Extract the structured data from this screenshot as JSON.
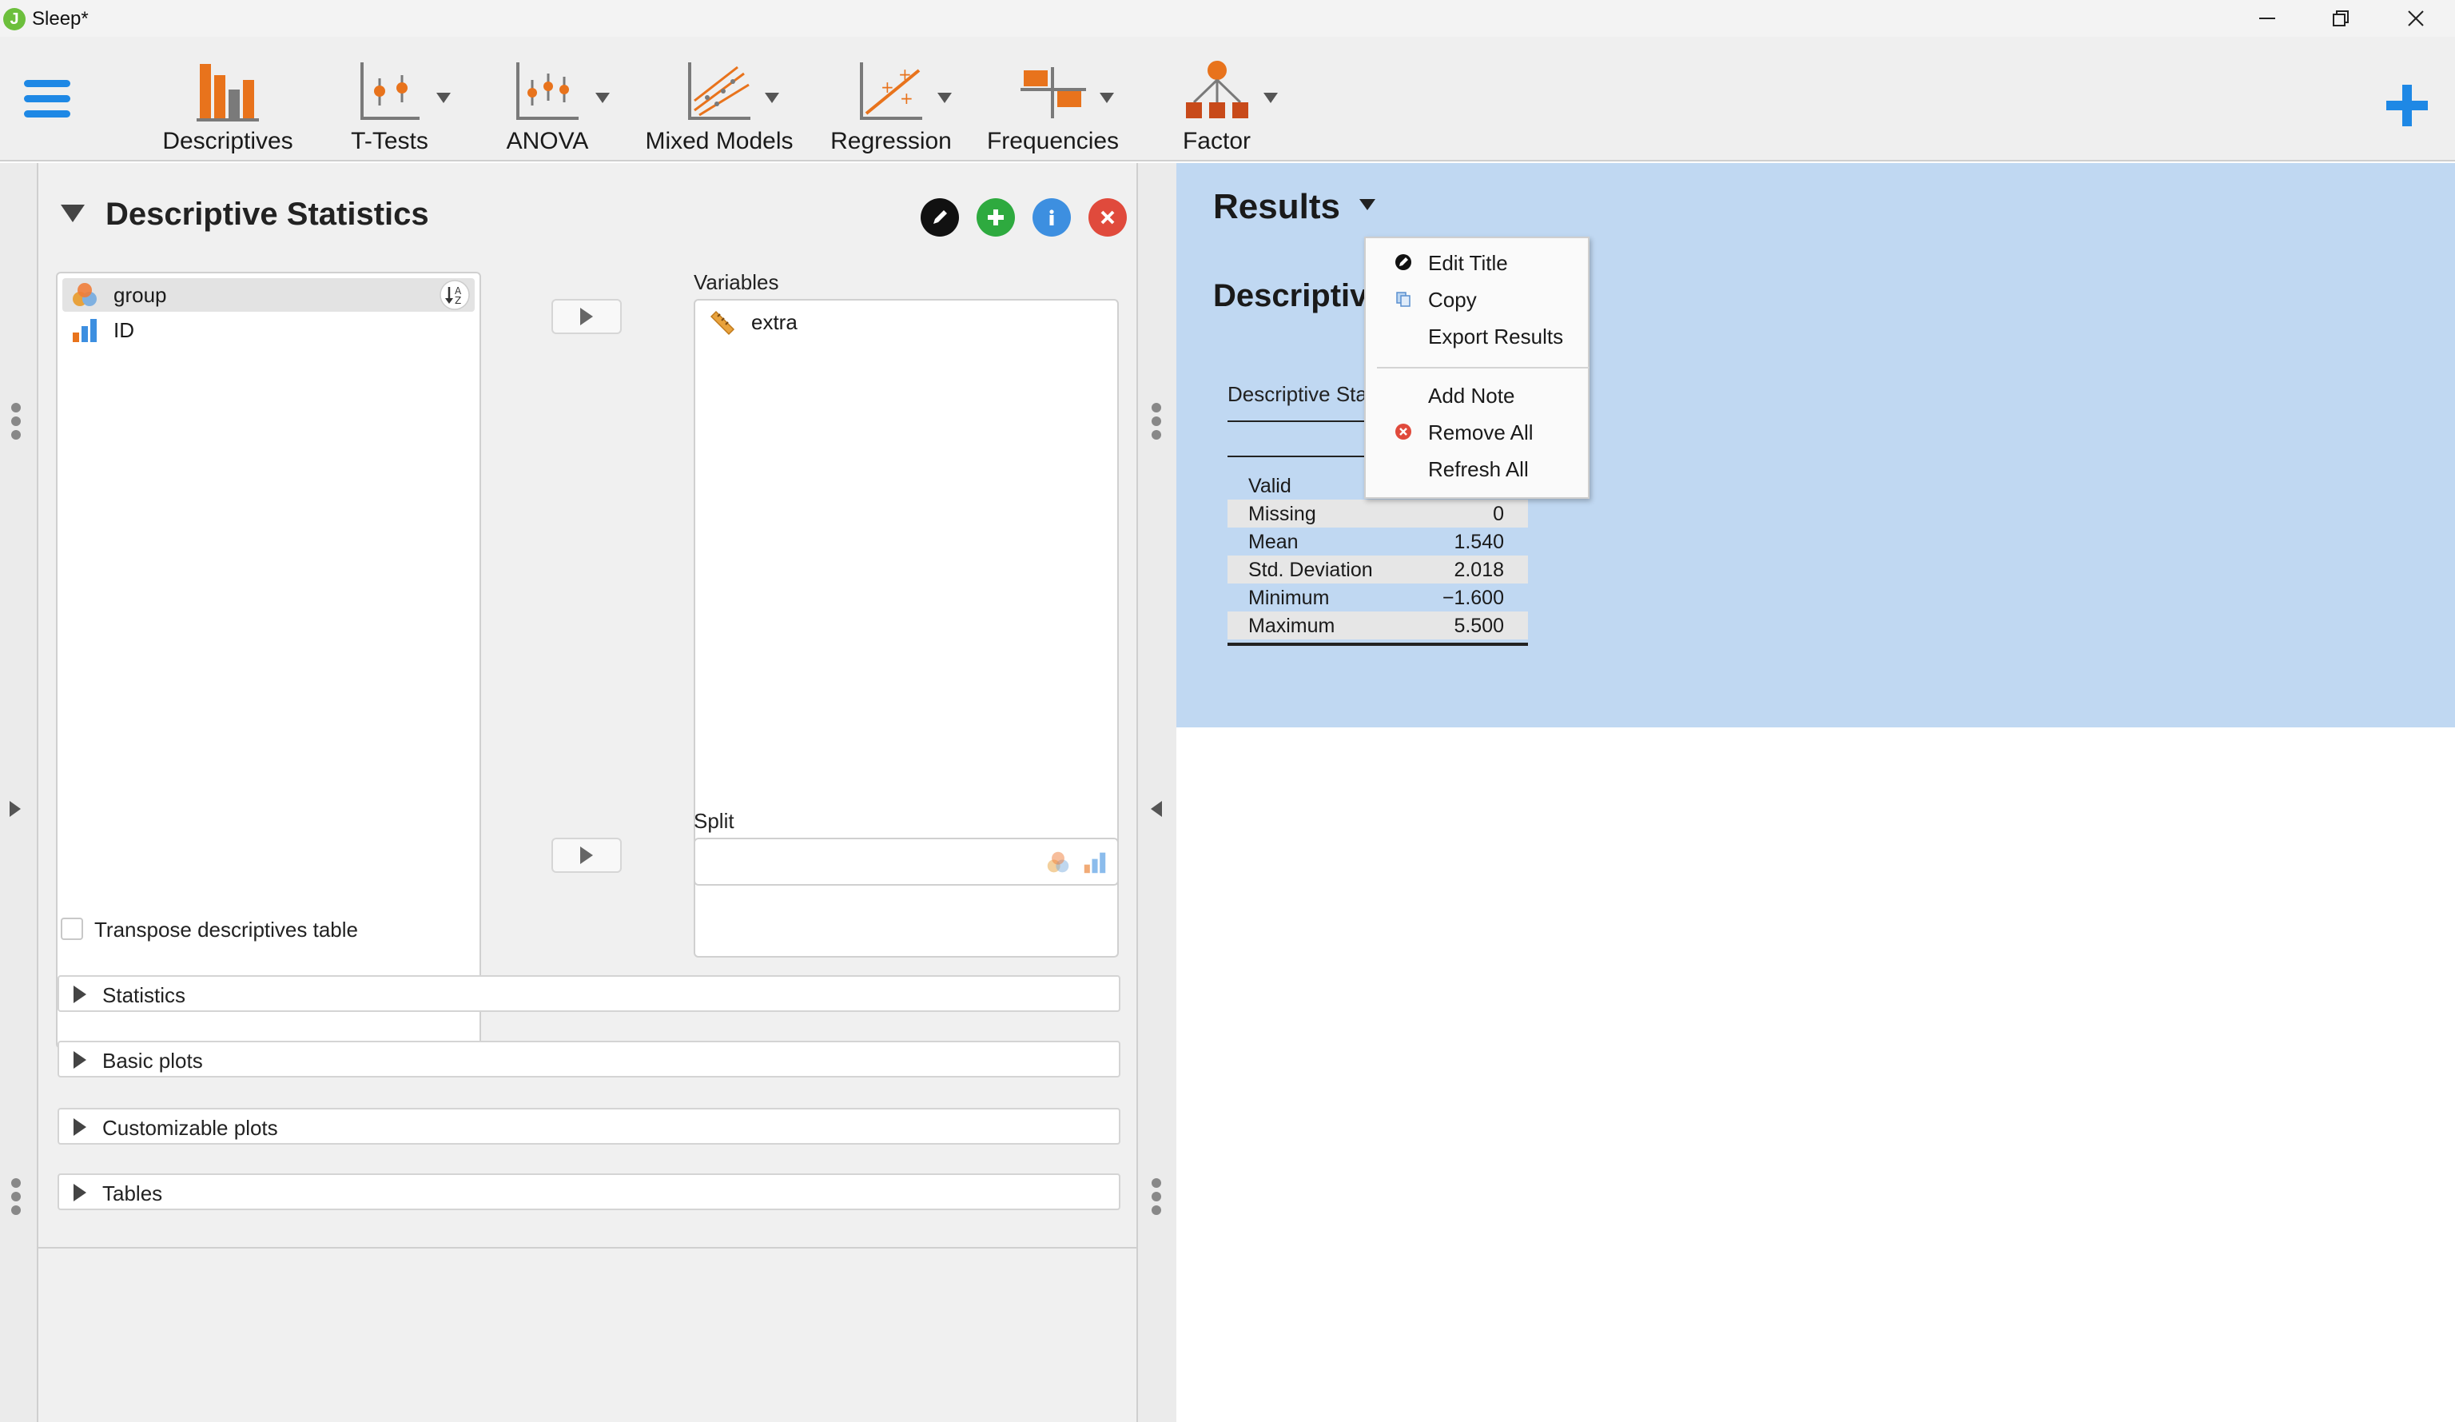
{
  "window": {
    "title": "Sleep*"
  },
  "ribbon": {
    "items": [
      {
        "label": "Descriptives"
      },
      {
        "label": "T-Tests"
      },
      {
        "label": "ANOVA"
      },
      {
        "label": "Mixed Models"
      },
      {
        "label": "Regression"
      },
      {
        "label": "Frequencies"
      },
      {
        "label": "Factor"
      }
    ]
  },
  "analysis": {
    "title": "Descriptive Statistics",
    "source_vars": [
      {
        "name": "group",
        "type": "nominal"
      },
      {
        "name": "ID",
        "type": "scale"
      }
    ],
    "variables_label": "Variables",
    "variables": [
      {
        "name": "extra",
        "type": "continuous"
      }
    ],
    "split_label": "Split",
    "transpose_label": "Transpose descriptives table",
    "sections": [
      {
        "label": "Statistics"
      },
      {
        "label": "Basic plots"
      },
      {
        "label": "Customizable plots"
      },
      {
        "label": "Tables"
      }
    ]
  },
  "results": {
    "title": "Results",
    "analysis_title": "Descriptive Statistics",
    "table_caption": "Descriptive Statistics",
    "rows": [
      {
        "label": "Valid",
        "value": ""
      },
      {
        "label": "Missing",
        "value": "0"
      },
      {
        "label": "Mean",
        "value": "1.540"
      },
      {
        "label": "Std. Deviation",
        "value": "2.018"
      },
      {
        "label": "Minimum",
        "value": "−1.600"
      },
      {
        "label": "Maximum",
        "value": "5.500"
      }
    ]
  },
  "context_menu": {
    "items": [
      {
        "label": "Edit Title",
        "icon": "pencil-icon"
      },
      {
        "label": "Copy",
        "icon": "copy-icon"
      },
      {
        "label": "Export Results",
        "icon": ""
      },
      {
        "label": "Add Note",
        "icon": ""
      },
      {
        "label": "Remove All",
        "icon": "remove-icon"
      },
      {
        "label": "Refresh All",
        "icon": ""
      }
    ]
  },
  "colors": {
    "accent_blue": "#1e88e5",
    "icon_orange": "#e8731c",
    "results_bg": "#c0d8f2",
    "edit_btn": "#111111",
    "add_btn": "#2eaa3f",
    "info_btn": "#3d8fe0",
    "close_btn": "#e04a3c"
  }
}
